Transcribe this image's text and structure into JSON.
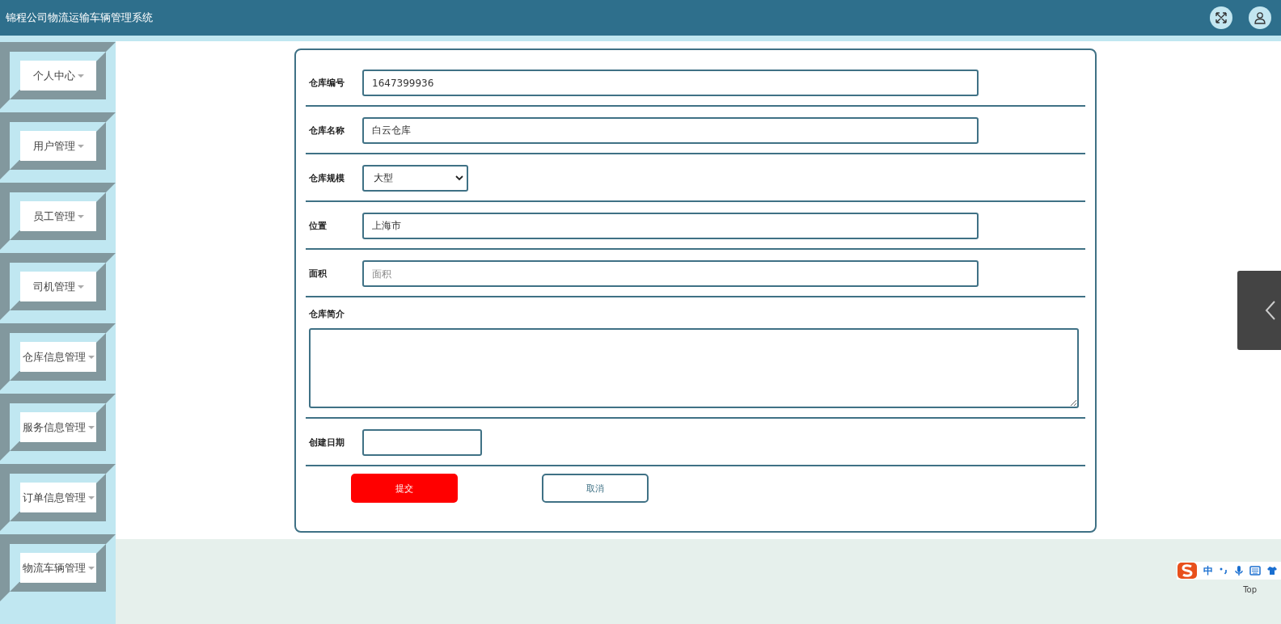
{
  "header": {
    "title": "锦程公司物流运输车辆管理系统"
  },
  "sidebar": {
    "items": [
      {
        "label": "个人中心"
      },
      {
        "label": "用户管理"
      },
      {
        "label": "员工管理"
      },
      {
        "label": "司机管理"
      },
      {
        "label": "仓库信息管理"
      },
      {
        "label": "服务信息管理"
      },
      {
        "label": "订单信息管理"
      },
      {
        "label": "物流车辆管理"
      }
    ]
  },
  "form": {
    "fields": [
      {
        "kind": "text",
        "label": "仓库编号",
        "value": "1647399936"
      },
      {
        "kind": "text",
        "label": "仓库名称",
        "value": "白云仓库"
      },
      {
        "kind": "select",
        "label": "仓库规模",
        "value": "大型"
      },
      {
        "kind": "text",
        "label": "位置",
        "value": "上海市"
      },
      {
        "kind": "text",
        "label": "面积",
        "placeholder": "面积"
      },
      {
        "kind": "textarea",
        "label": "仓库简介"
      },
      {
        "kind": "date",
        "label": "创建日期"
      }
    ],
    "buttons": [
      {
        "kind": "primary",
        "label": "提交"
      },
      {
        "kind": "secondary",
        "label": "取消"
      }
    ]
  },
  "ime_toolbar": {
    "mode": "中"
  },
  "back_to_top": {
    "label": "Top"
  }
}
